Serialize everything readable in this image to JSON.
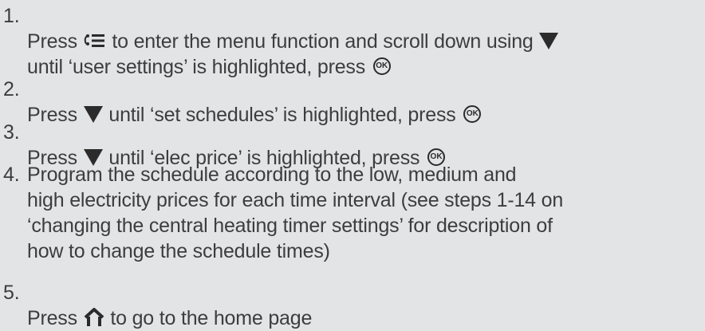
{
  "steps": [
    {
      "number": "1.",
      "parts": [
        "Press ",
        " to enter the menu function and scroll down using ",
        "\nuntil ‘user settings’ is highlighted, press "
      ],
      "icons": [
        "menu-icon",
        "down-triangle-icon",
        "ok-button-icon"
      ]
    },
    {
      "number": "2.",
      "parts": [
        "Press ",
        " until ‘set schedules’ is highlighted, press "
      ],
      "icons": [
        "down-triangle-icon",
        "ok-button-icon"
      ]
    },
    {
      "number": "3.",
      "parts": [
        "Press ",
        " until ‘elec price’ is highlighted, press "
      ],
      "icons": [
        "down-triangle-icon",
        "ok-button-icon"
      ]
    },
    {
      "number": "4.",
      "text": "Program the schedule according to the low, medium and\nhigh electricity prices for each time interval (see steps 1-14 on\n‘changing the central heating timer settings’ for description of\nhow to change the schedule times)"
    },
    {
      "number": "5.",
      "parts": [
        "Press ",
        " to go to the home page"
      ],
      "icons": [
        "home-icon"
      ]
    }
  ],
  "ok_label": "OK",
  "colors": {
    "background": "#e3e4e6",
    "text": "#3d3d3d",
    "icon": "#2b2b2b"
  }
}
